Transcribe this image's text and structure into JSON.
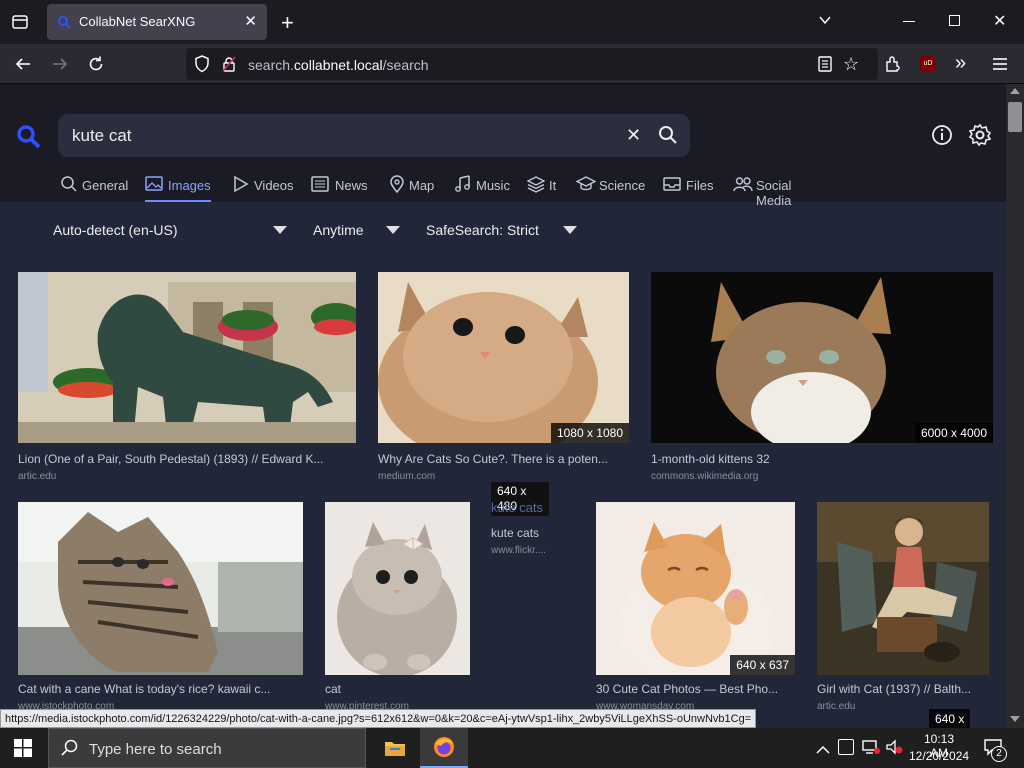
{
  "browser": {
    "tab_title": "CollabNet SearXNG",
    "url_prefix": "search.",
    "url_domain": "collabnet.local",
    "url_path": "/search"
  },
  "search": {
    "query": "kute cat"
  },
  "categories": [
    {
      "label": "General",
      "icon": "search-icon"
    },
    {
      "label": "Images",
      "icon": "image-icon",
      "active": true
    },
    {
      "label": "Videos",
      "icon": "play-icon"
    },
    {
      "label": "News",
      "icon": "newspaper-icon"
    },
    {
      "label": "Map",
      "icon": "map-pin-icon"
    },
    {
      "label": "Music",
      "icon": "music-icon"
    },
    {
      "label": "It",
      "icon": "layers-icon"
    },
    {
      "label": "Science",
      "icon": "graduation-cap-icon"
    },
    {
      "label": "Files",
      "icon": "inbox-icon"
    },
    {
      "label": "Social Media",
      "icon": "users-icon"
    }
  ],
  "filters": {
    "language": "Auto-detect (en-US)",
    "time": "Anytime",
    "safesearch": "SafeSearch: Strict"
  },
  "results": [
    {
      "title": "Lion (One of a Pair, South Pedestal) (1893) // Edward K...",
      "source": "artic.edu",
      "dims": ""
    },
    {
      "title": "Why Are Cats So Cute?. There is a poten...",
      "source": "medium.com",
      "dims": "1080 x 1080"
    },
    {
      "title": "1-month-old kittens 32",
      "source": "commons.wikimedia.org",
      "dims": "6000 x 4000"
    },
    {
      "title": "Cat with a cane What is today's rice? kawaii c...",
      "source": "www.istockphoto.com",
      "dims": ""
    },
    {
      "title": "cat",
      "source": "www.pinterest.com",
      "dims": ""
    },
    {
      "title": "kute cats",
      "source": "www.flickr....",
      "dims": "640 x 480",
      "broken_image_alt": "kute cats"
    },
    {
      "title": "30 Cute Cat Photos — Best Pho...",
      "source": "www.womansday.com",
      "dims": "640 x 637"
    },
    {
      "title": "Girl with Cat (1937) // Balth...",
      "source": "artic.edu",
      "dims": "640 x"
    }
  ],
  "status_url": "https://media.istockphoto.com/id/1226324229/photo/cat-with-a-cane.jpg?s=612x612&w=0&k=20&c=eAj-ytwVsp1-lihx_2wby5ViLLgeXhSS-oUnwNvb1Cg=",
  "taskbar": {
    "search_placeholder": "Type here to search",
    "time": "10:13 AM",
    "date": "12/20/2024",
    "notification_count": "2"
  },
  "colors": {
    "accent": "#6a8cff",
    "page_bg": "#222639",
    "header_bg": "#1a1b24"
  }
}
